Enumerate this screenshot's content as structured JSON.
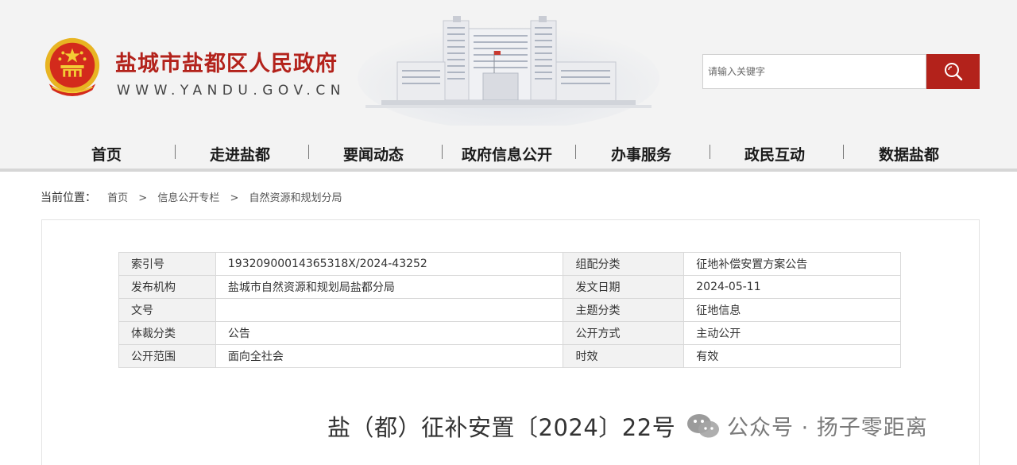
{
  "header": {
    "site_title": "盐城市盐都区人民政府",
    "site_url": "WWW.YANDU.GOV.CN",
    "emblem_icon": "national-emblem-icon",
    "building_image": "government-building-illustration"
  },
  "search": {
    "placeholder": "请输入关键字",
    "button_icon": "search-icon",
    "button_color": "#b3221b"
  },
  "nav": {
    "items": [
      "首页",
      "走进盐都",
      "要闻动态",
      "政府信息公开",
      "办事服务",
      "政民互动",
      "数据盐都"
    ],
    "separator": "|"
  },
  "breadcrumb": {
    "label": "当前位置：",
    "items": [
      "首页",
      "信息公开专栏",
      "自然资源和规划分局"
    ],
    "separator": ">"
  },
  "meta_table": {
    "rows": [
      {
        "k1": "索引号",
        "v1": "1932090001436531​8X/2024-43252",
        "k2": "组配分类",
        "v2": "征地补偿安置方案公告"
      },
      {
        "k1": "发布机构",
        "v1": "盐城市自然资源和规划局盐都分局",
        "k2": "发文日期",
        "v2": "2024-05-11"
      },
      {
        "k1": "文号",
        "v1": "",
        "k2": "主题分类",
        "v2": "征地信息"
      },
      {
        "k1": "体裁分类",
        "v1": "公告",
        "k2": "公开方式",
        "v2": "主动公开"
      },
      {
        "k1": "公开范围",
        "v1": "面向全社会",
        "k2": "时效",
        "v2": "有效"
      }
    ]
  },
  "document": {
    "title": "盐（都）征补安置〔2024〕22号"
  },
  "watermark": {
    "text": "公众号 · 扬子零距离",
    "icon": "wechat-icon"
  },
  "colors": {
    "brand_red": "#b3221b",
    "header_bg": "#f3f3f3"
  }
}
